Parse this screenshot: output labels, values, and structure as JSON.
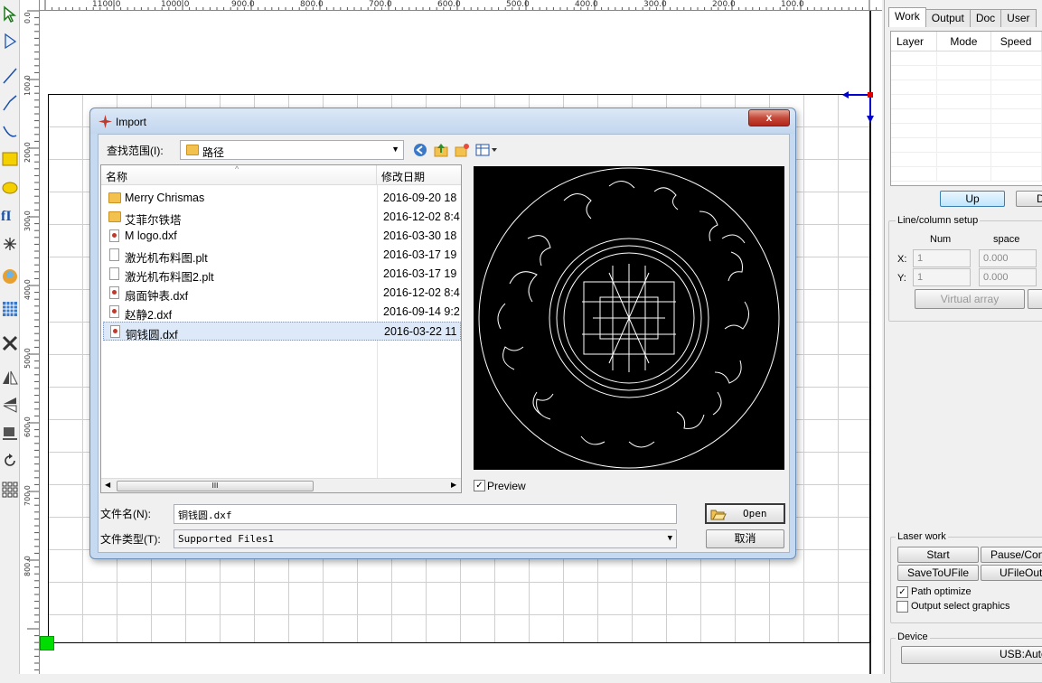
{
  "toolbar": {
    "tools": [
      "select-arrow-icon",
      "node-edit-icon",
      "line-icon",
      "polyline-icon",
      "curve-icon",
      "rectangle-icon",
      "ellipse-icon",
      "text-icon",
      "point-icon",
      "bitmap-icon",
      "array-icon",
      "delete-icon",
      "mirror-horizontal-icon",
      "mirror-vertical-icon",
      "align-icon",
      "rotate-icon",
      "grid-icon"
    ]
  },
  "ruler": {
    "h_labels": [
      "1100.0",
      "1000.0",
      "900.0",
      "800.0",
      "700.0",
      "600.0",
      "500.0",
      "400.0",
      "300.0",
      "200.0",
      "100.0"
    ],
    "v_labels": [
      "0.0",
      "100.0",
      "200.0",
      "300.0",
      "400.0",
      "500.0",
      "600.0",
      "700.0",
      "800.0"
    ]
  },
  "right_panel": {
    "tabs": [
      "Work",
      "Output",
      "Doc",
      "User"
    ],
    "layer_columns": [
      "Layer",
      "Mode",
      "Speed"
    ],
    "up_button": "Up",
    "down_button": "D",
    "line_column_setup": {
      "title": "Line/column setup",
      "num_header": "Num",
      "space_header": "space",
      "x_label": "X:",
      "y_label": "Y:",
      "x_num": "1",
      "x_space": "0.000",
      "y_num": "1",
      "y_space": "0.000",
      "virtual_array": "Virtual array"
    },
    "laser_work": {
      "title": "Laser work",
      "start": "Start",
      "pause": "Pause/Conti",
      "save_to_ufile": "SaveToUFile",
      "ufile_output": "UFileOutpu",
      "path_optimize": "Path optimize",
      "output_select": "Output select graphics"
    },
    "device": {
      "title": "Device",
      "value": "USB:Auto"
    }
  },
  "dialog": {
    "title": "Import",
    "close": "x",
    "look_in_label": "查找范围(I):",
    "look_in_value": "路径",
    "columns": {
      "name": "名称",
      "date": "修改日期"
    },
    "files": [
      {
        "name": "Merry Chrismas",
        "date": "2016-09-20 18",
        "type": "folder"
      },
      {
        "name": "艾菲尔铁塔",
        "date": "2016-12-02 8:4",
        "type": "folder"
      },
      {
        "name": "M logo.dxf",
        "date": "2016-03-30 18",
        "type": "dxf"
      },
      {
        "name": "激光机布料图.plt",
        "date": "2016-03-17 19",
        "type": "plt"
      },
      {
        "name": "激光机布料图2.plt",
        "date": "2016-03-17 19",
        "type": "plt"
      },
      {
        "name": "扇面钟表.dxf",
        "date": "2016-12-02 8:4",
        "type": "dxf"
      },
      {
        "name": "赵静2.dxf",
        "date": "2016-09-14 9:2",
        "type": "dxf"
      },
      {
        "name": "铜钱圆.dxf",
        "date": "2016-03-22 11",
        "type": "dxf",
        "selected": true
      }
    ],
    "scroll_thumb": "III",
    "preview_label": "Preview",
    "preview_checked": true,
    "filename_label": "文件名(N):",
    "filename_value": "铜钱圆.dxf",
    "filetype_label": "文件类型(T):",
    "filetype_value": "Supported Files1",
    "open_button": "Open",
    "cancel_button": "取消"
  }
}
